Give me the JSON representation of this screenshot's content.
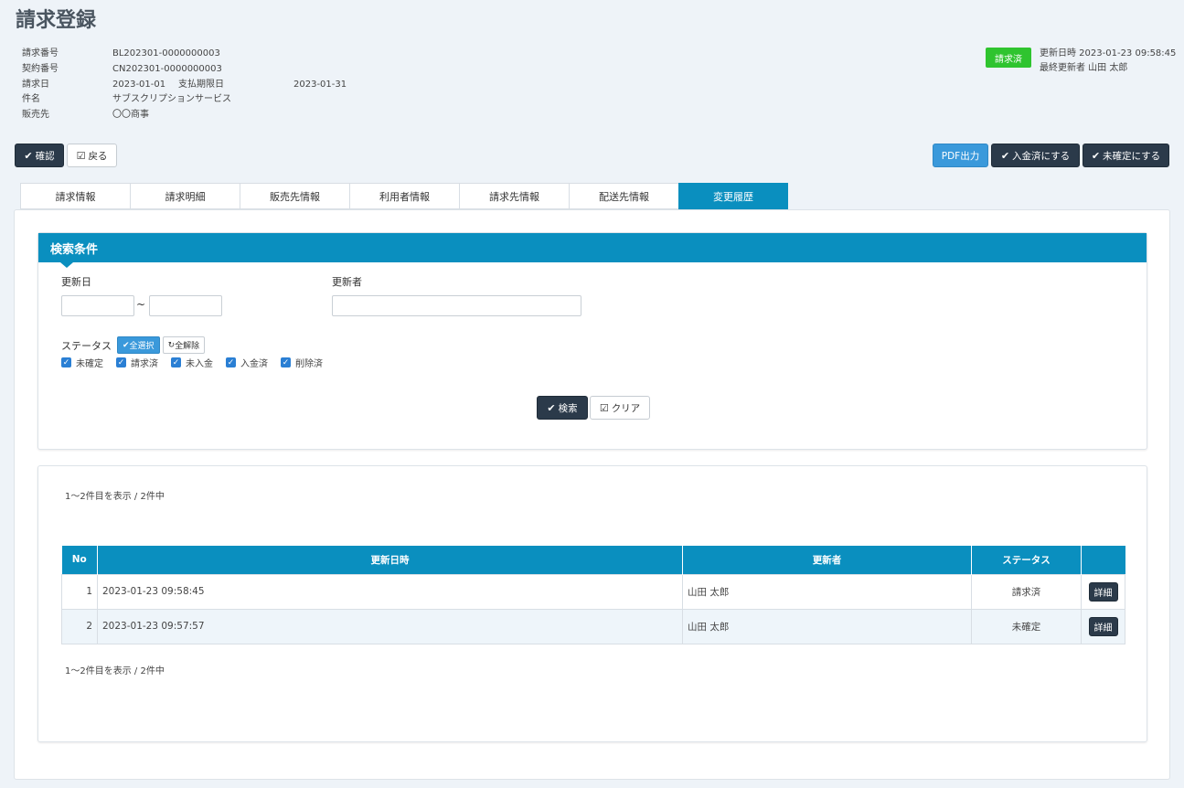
{
  "page": {
    "title": "請求登録"
  },
  "meta": {
    "invoice_no_label": "請求番号",
    "invoice_no": "BL202301-0000000003",
    "contract_no_label": "契約番号",
    "contract_no": "CN202301-0000000003",
    "invoice_date_label": "請求日",
    "invoice_date": "2023-01-01",
    "due_date_label": "支払期限日",
    "due_date": "2023-01-31",
    "subject_label": "件名",
    "subject": "サブスクリプションサービス",
    "customer_label": "販売先",
    "customer": "〇〇商事"
  },
  "status": {
    "badge": "請求済",
    "badge_color": "#2fc42f",
    "updated_at": "更新日時 2023-01-23 09:58:45",
    "updated_by": "最終更新者 山田 太郎"
  },
  "toolbar": {
    "confirm": "確認",
    "back": "戻る",
    "pdf": "PDF出力",
    "mark_paid": "入金済にする",
    "mark_unconfirmed": "未確定にする"
  },
  "tabs": [
    {
      "label": "請求情報"
    },
    {
      "label": "請求明細"
    },
    {
      "label": "販売先情報"
    },
    {
      "label": "利用者情報"
    },
    {
      "label": "請求先情報"
    },
    {
      "label": "配送先情報"
    },
    {
      "label": "変更履歴",
      "active": true
    }
  ],
  "search": {
    "title": "検索条件",
    "updated_date_label": "更新日",
    "date_from": "",
    "date_to": "",
    "tilde": "~",
    "updater_label": "更新者",
    "updater": "",
    "status_label": "ステータス",
    "select_all": "全選択",
    "clear_all": "全解除",
    "statuses": [
      "未確定",
      "請求済",
      "未入金",
      "入金済",
      "削除済"
    ],
    "search_button": "検索",
    "clear_button": "クリア"
  },
  "results": {
    "count_text_top": "1～2件目を表示 / 2件中",
    "count_text_bottom": "1～2件目を表示 / 2件中",
    "columns": [
      "No",
      "更新日時",
      "更新者",
      "ステータス",
      ""
    ],
    "rows": [
      {
        "no": "1",
        "updated_at": "2023-01-23 09:58:45",
        "updater": "山田 太郎",
        "status": "請求済",
        "action": "詳細"
      },
      {
        "no": "2",
        "updated_at": "2023-01-23 09:57:57",
        "updater": "山田 太郎",
        "status": "未確定",
        "action": "詳細"
      }
    ]
  },
  "colors": {
    "accent": "#0a8fbf",
    "dark_button": "#2b3a4a",
    "pdf_button": "#3a99db"
  }
}
